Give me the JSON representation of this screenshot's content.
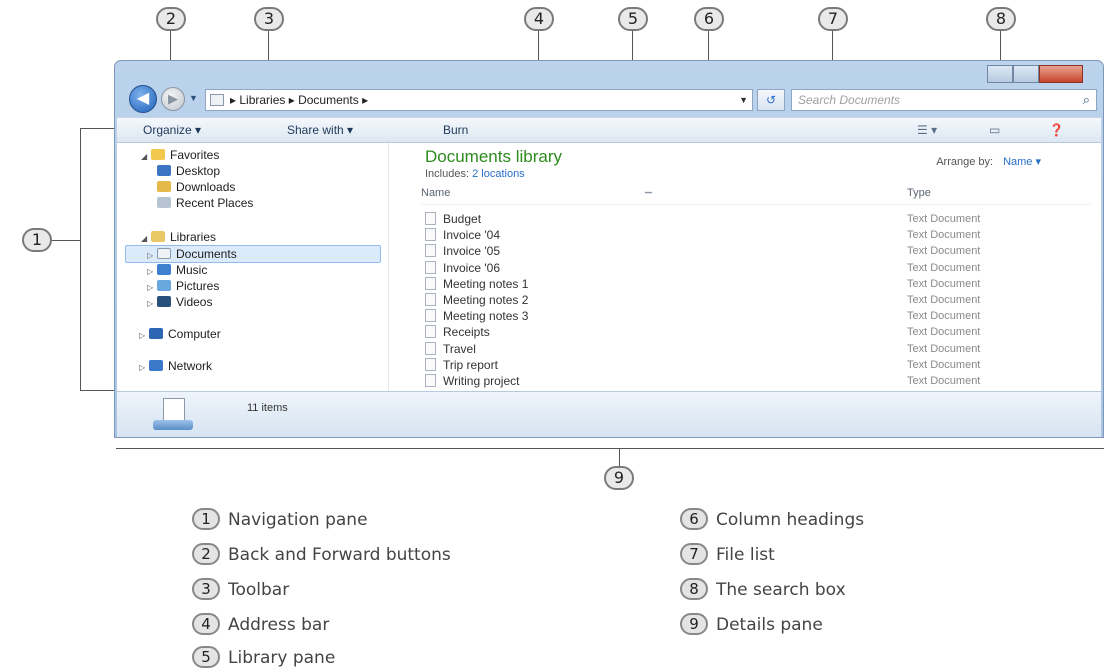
{
  "callouts": [
    "1",
    "2",
    "3",
    "4",
    "5",
    "6",
    "7",
    "8",
    "9"
  ],
  "window": {
    "address": {
      "path": "▸ Libraries ▸ Documents ▸"
    },
    "search_placeholder": "Search Documents",
    "toolbar": {
      "organize": "Organize ▾",
      "share": "Share with ▾",
      "burn": "Burn"
    },
    "nav": {
      "favorites": "Favorites",
      "desktop": "Desktop",
      "downloads": "Downloads",
      "recent": "Recent Places",
      "libraries": "Libraries",
      "documents": "Documents",
      "music": "Music",
      "pictures": "Pictures",
      "videos": "Videos",
      "computer": "Computer",
      "network": "Network"
    },
    "library": {
      "title": "Documents library",
      "includes_label": "Includes:",
      "includes_link": "2 locations",
      "arrange_label": "Arrange by:",
      "arrange_value": "Name ▾"
    },
    "columns": {
      "name": "Name",
      "type": "Type"
    },
    "files": [
      {
        "name": "Budget",
        "type": "Text Document"
      },
      {
        "name": "Invoice '04",
        "type": "Text Document"
      },
      {
        "name": "Invoice '05",
        "type": "Text Document"
      },
      {
        "name": "Invoice '06",
        "type": "Text Document"
      },
      {
        "name": "Meeting notes 1",
        "type": "Text Document"
      },
      {
        "name": "Meeting notes 2",
        "type": "Text Document"
      },
      {
        "name": "Meeting notes 3",
        "type": "Text Document"
      },
      {
        "name": "Receipts",
        "type": "Text Document"
      },
      {
        "name": "Travel",
        "type": "Text Document"
      },
      {
        "name": "Trip report",
        "type": "Text Document"
      },
      {
        "name": "Writing project",
        "type": "Text Document"
      }
    ],
    "details": {
      "count": "11 items"
    }
  },
  "legend": [
    {
      "num": "1",
      "label": "Navigation pane"
    },
    {
      "num": "2",
      "label": "Back and Forward buttons"
    },
    {
      "num": "3",
      "label": "Toolbar"
    },
    {
      "num": "4",
      "label": "Address bar"
    },
    {
      "num": "5",
      "label": "Library pane"
    },
    {
      "num": "6",
      "label": "Column headings"
    },
    {
      "num": "7",
      "label": "File list"
    },
    {
      "num": "8",
      "label": "The search box"
    },
    {
      "num": "9",
      "label": "Details pane"
    }
  ]
}
